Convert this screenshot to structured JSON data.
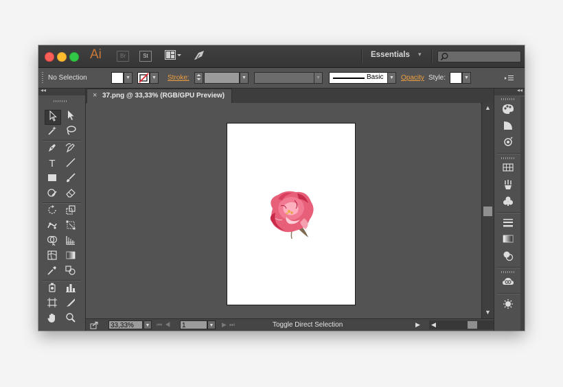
{
  "titlebar": {
    "app_logo": "Ai",
    "br_label": "Br",
    "st_label": "St",
    "workspace": "Essentials",
    "workspace_caret": "▾",
    "search_placeholder": ""
  },
  "controlbar": {
    "selection_label": "No Selection",
    "stroke_label": "Stroke:",
    "brush_label": "Basic",
    "opacity_label": "Opacity",
    "style_label": "Style:"
  },
  "document": {
    "tab_close": "×",
    "tab_title": "37.png @ 33,33% (RGB/GPU Preview)"
  },
  "statusbar": {
    "zoom": "33,33%",
    "artboard_number": "1",
    "status_text": "Toggle Direct Selection"
  },
  "colors": {
    "accent_orange": "#f0a040",
    "ai_logo": "#c9793a",
    "artboard": "#ffffff",
    "chrome_gray": "#535353"
  },
  "tools": [
    "selection-tool",
    "direct-selection-tool",
    "magic-wand-tool",
    "lasso-tool",
    "pen-tool",
    "curvature-tool",
    "type-tool",
    "line-segment-tool",
    "rectangle-tool",
    "paintbrush-tool",
    "shaper-tool",
    "eraser-tool",
    "rotate-tool",
    "scale-tool",
    "puppet-warp-tool",
    "free-transform-tool",
    "shape-builder-tool",
    "perspective-grid-tool",
    "mesh-tool",
    "gradient-tool",
    "eyedropper-tool",
    "blend-tool",
    "symbol-sprayer-tool",
    "column-graph-tool",
    "artboard-tool",
    "slice-tool",
    "hand-tool",
    "zoom-tool"
  ],
  "right_panels": [
    "color-panel",
    "color-guide-panel",
    "appearance-panel",
    "swatches-panel",
    "brushes-panel",
    "symbols-panel",
    "stroke-panel",
    "gradient-panel",
    "transparency-panel",
    "libraries-panel",
    "graphic-styles-panel"
  ]
}
